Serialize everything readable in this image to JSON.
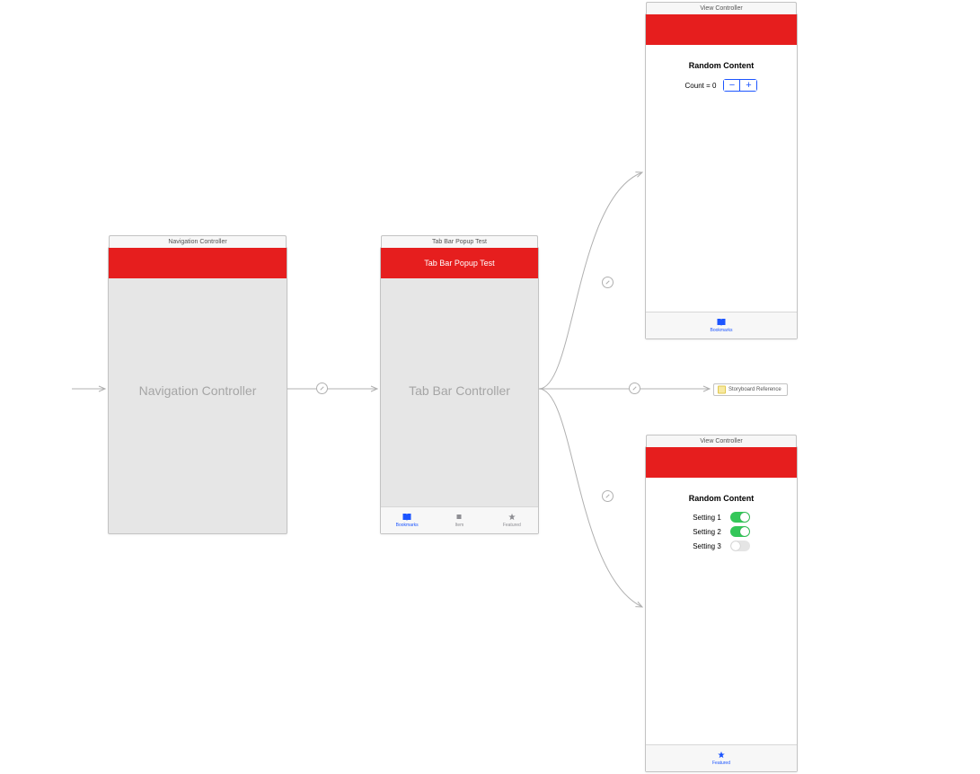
{
  "scenes": {
    "nav": {
      "title": "Navigation Controller",
      "body_label": "Navigation Controller"
    },
    "tab": {
      "title": "Tab Bar Popup Test",
      "nav_title": "Tab Bar Popup Test",
      "body_label": "Tab Bar Controller",
      "tabs": [
        {
          "label": "Bookmarks",
          "selected": true,
          "icon": "bookmarks-icon"
        },
        {
          "label": "Item",
          "selected": false,
          "icon": "item-icon"
        },
        {
          "label": "Featured",
          "selected": false,
          "icon": "featured-icon"
        }
      ]
    },
    "vc1": {
      "title": "View Controller",
      "section_title": "Random Content",
      "count_label": "Count = 0",
      "tabs": [
        {
          "label": "Bookmarks",
          "selected": true,
          "icon": "bookmarks-icon"
        }
      ]
    },
    "storyref": {
      "label": "Storyboard Reference"
    },
    "vc2": {
      "title": "View Controller",
      "section_title": "Random Content",
      "settings": [
        {
          "label": "Setting 1",
          "on": true
        },
        {
          "label": "Setting 2",
          "on": true
        },
        {
          "label": "Setting 3",
          "on": false
        }
      ],
      "tabs": [
        {
          "label": "Featured",
          "selected": true,
          "icon": "featured-icon"
        }
      ]
    }
  },
  "colors": {
    "navbar": "#e61e1e",
    "accent": "#1c55ff",
    "switch_on": "#34c759"
  }
}
